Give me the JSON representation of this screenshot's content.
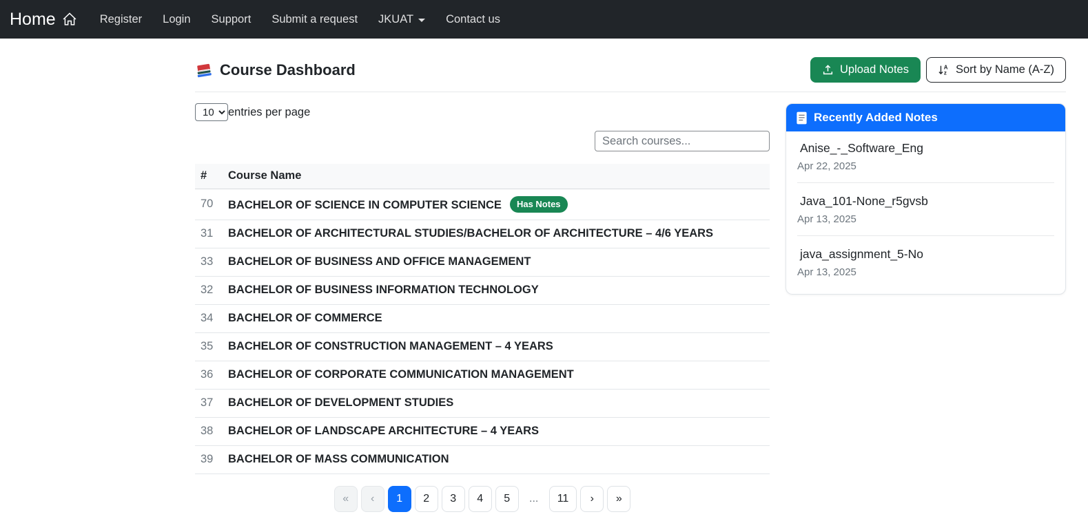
{
  "navbar": {
    "brand": "Home",
    "links": [
      {
        "label": "Register",
        "dropdown": false
      },
      {
        "label": "Login",
        "dropdown": false
      },
      {
        "label": "Support",
        "dropdown": false
      },
      {
        "label": "Submit a request",
        "dropdown": false
      },
      {
        "label": "JKUAT",
        "dropdown": true
      },
      {
        "label": "Contact us",
        "dropdown": false
      }
    ]
  },
  "header": {
    "title": "Course Dashboard",
    "upload_button": "Upload Notes",
    "sort_button": "Sort by Name (A-Z)"
  },
  "table_controls": {
    "entries_value": "10",
    "entries_label": "entries per page",
    "search_placeholder": "Search courses..."
  },
  "table": {
    "columns": [
      "#",
      "Course Name"
    ],
    "rows": [
      {
        "num": "70",
        "name": "BACHELOR OF SCIENCE IN COMPUTER SCIENCE",
        "badge": "Has Notes"
      },
      {
        "num": "31",
        "name": "BACHELOR OF ARCHITECTURAL STUDIES/BACHELOR OF ARCHITECTURE – 4/6 YEARS",
        "badge": null
      },
      {
        "num": "33",
        "name": "BACHELOR OF BUSINESS AND OFFICE MANAGEMENT",
        "badge": null
      },
      {
        "num": "32",
        "name": "BACHELOR OF BUSINESS INFORMATION TECHNOLOGY",
        "badge": null
      },
      {
        "num": "34",
        "name": "BACHELOR OF COMMERCE",
        "badge": null
      },
      {
        "num": "35",
        "name": "BACHELOR OF CONSTRUCTION MANAGEMENT – 4 YEARS",
        "badge": null
      },
      {
        "num": "36",
        "name": "BACHELOR OF CORPORATE COMMUNICATION MANAGEMENT",
        "badge": null
      },
      {
        "num": "37",
        "name": "BACHELOR OF DEVELOPMENT STUDIES",
        "badge": null
      },
      {
        "num": "38",
        "name": "BACHELOR OF LANDSCAPE ARCHITECTURE – 4 YEARS",
        "badge": null
      },
      {
        "num": "39",
        "name": "BACHELOR OF MASS COMMUNICATION",
        "badge": null
      }
    ]
  },
  "pagination": {
    "items": [
      {
        "label": "«",
        "type": "disabled",
        "name": "first-page"
      },
      {
        "label": "‹",
        "type": "disabled",
        "name": "prev-page"
      },
      {
        "label": "1",
        "type": "active",
        "name": "page-1"
      },
      {
        "label": "2",
        "type": "normal",
        "name": "page-2"
      },
      {
        "label": "3",
        "type": "normal",
        "name": "page-3"
      },
      {
        "label": "4",
        "type": "normal",
        "name": "page-4"
      },
      {
        "label": "5",
        "type": "normal",
        "name": "page-5"
      },
      {
        "label": "...",
        "type": "ellipsis",
        "name": "ellipsis"
      },
      {
        "label": "11",
        "type": "normal",
        "name": "page-11"
      },
      {
        "label": "›",
        "type": "normal",
        "name": "next-page"
      },
      {
        "label": "»",
        "type": "normal",
        "name": "last-page"
      }
    ]
  },
  "sidebar": {
    "title": "Recently Added Notes",
    "notes": [
      {
        "title": "Anise_-_Software_Eng",
        "date": "Apr 22, 2025"
      },
      {
        "title": "Java_101-None_r5gvsb",
        "date": "Apr 13, 2025"
      },
      {
        "title": "java_assignment_5-No",
        "date": "Apr 13, 2025"
      }
    ]
  },
  "icons": {
    "brand": "house-icon",
    "title": "books-icon",
    "upload": "upload-icon",
    "sort": "sort-alpha-down-icon",
    "sidebar_header": "file-text-icon"
  },
  "colors": {
    "navbar_bg": "#212529",
    "success_green": "#198754",
    "primary_blue": "#0d6efd",
    "muted_text": "#6c757d",
    "border": "#dee2e6"
  }
}
